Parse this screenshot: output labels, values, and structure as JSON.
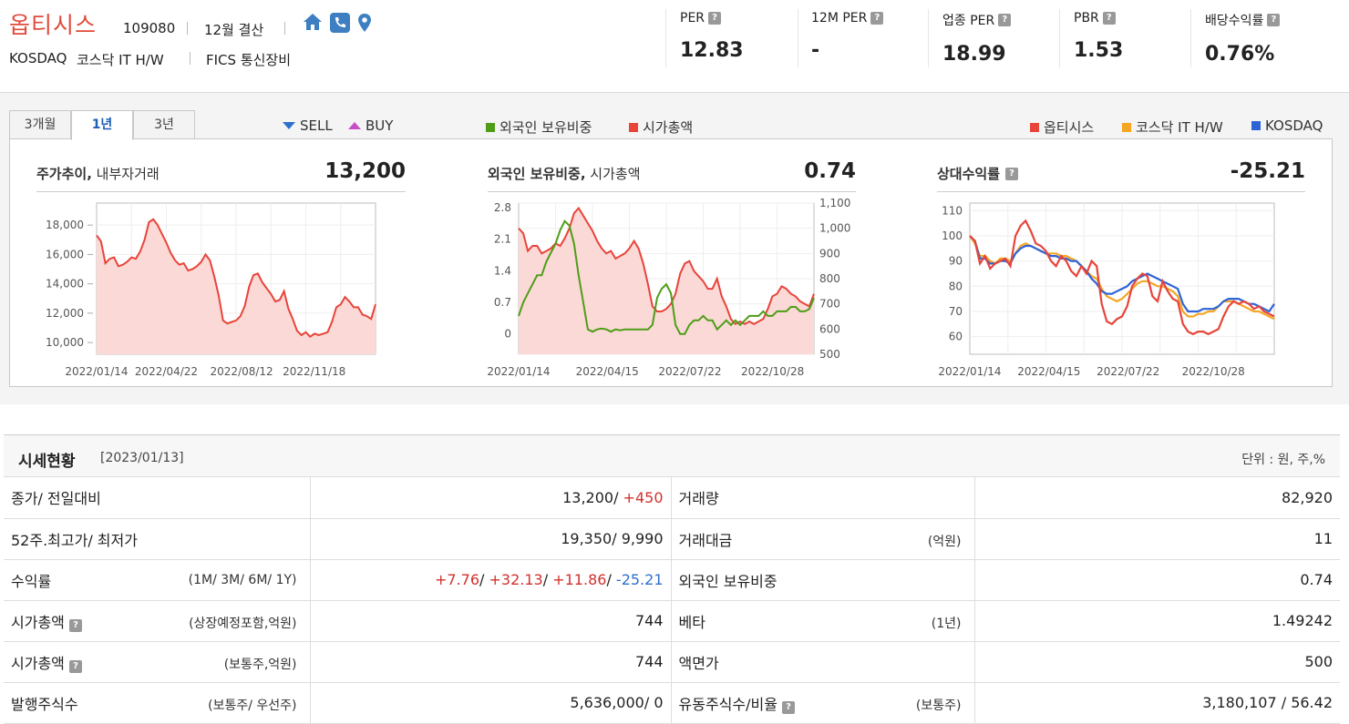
{
  "header": {
    "company": "옵티시스",
    "code": "109080",
    "fiscal": "12월 결산",
    "market": "KOSDAQ",
    "sector": "코스닥 IT H/W",
    "fics": "FICS 통신장비",
    "icons": [
      "home-icon",
      "phone-icon",
      "location-icon"
    ]
  },
  "metrics": [
    {
      "label": "PER",
      "value": "12.83"
    },
    {
      "label": "12M PER",
      "value": "-"
    },
    {
      "label": "업종 PER",
      "value": "18.99"
    },
    {
      "label": "PBR",
      "value": "1.53"
    },
    {
      "label": "배당수익률",
      "value": "0.76%"
    }
  ],
  "help_mark": "?",
  "tabs": [
    {
      "label": "3개월"
    },
    {
      "label": "1년",
      "active": true
    },
    {
      "label": "3년"
    }
  ],
  "legend": {
    "sell": "SELL",
    "buy": "BUY",
    "foreign": "외국인 보유비중",
    "mcap": "시가총액",
    "c1": "옵티시스",
    "c2": "코스닥 IT H/W",
    "c3": "KOSDAQ"
  },
  "colors": {
    "red": "#e8443a",
    "green": "#4e9d18",
    "orange": "#f5a623",
    "blue": "#2e64d6",
    "fill": "#fbd9d6",
    "sell": "#2e6fd0",
    "buy": "#c64fc6"
  },
  "panels": [
    {
      "title_bold": "주가추이,",
      "title_rest": " 내부자거래",
      "value": "13,200"
    },
    {
      "title_bold": "외국인 보유비중,",
      "title_rest": " 시가총액",
      "value": "0.74"
    },
    {
      "title_bold": "상대수익률",
      "title_rest": "",
      "value": "-25.21"
    }
  ],
  "chart_data": [
    {
      "type": "area",
      "series": [
        {
          "values": [
            17300,
            16900,
            15400,
            15700,
            15800,
            15200,
            15300,
            15500,
            15800,
            15700,
            16200,
            17000,
            18200,
            18400,
            18000,
            17400,
            16800,
            16100,
            15600,
            15300,
            15400,
            14900,
            15000,
            15200,
            15500,
            16000,
            15600,
            14500,
            13200,
            11500,
            11300,
            11400,
            11500,
            11800,
            12500,
            13800,
            14600,
            14700,
            14100,
            13700,
            13300,
            12800,
            12900,
            13500,
            12300,
            11600,
            10800,
            10500,
            10700,
            10400,
            10600,
            10500,
            10600,
            10700,
            11400,
            12400,
            12600,
            13100,
            12800,
            12400,
            12400,
            11900,
            11800,
            11600,
            12600
          ]
        }
      ],
      "y_ticks": [
        "18,000",
        "16,000",
        "14,000",
        "12,000",
        "10,000"
      ],
      "ylim": [
        9200,
        19500
      ],
      "x_ticks": [
        "2022/01/14",
        "2022/04/22",
        "2022/08/12",
        "2022/11/18"
      ]
    },
    {
      "type": "line",
      "series": [
        {
          "name": "외국인 보유비중",
          "axis": "left",
          "values": [
            0.4,
            0.7,
            0.9,
            1.1,
            1.3,
            1.3,
            1.6,
            1.8,
            2.0,
            2.3,
            2.5,
            2.4,
            2.0,
            1.3,
            0.7,
            0.1,
            0.05,
            0.1,
            0.12,
            0.1,
            0.05,
            0.1,
            0.08,
            0.1,
            0.1,
            0.1,
            0.1,
            0.1,
            0.1,
            0.2,
            0.8,
            1.0,
            1.1,
            0.9,
            0.2,
            0.0,
            0.0,
            0.2,
            0.3,
            0.3,
            0.4,
            0.3,
            0.3,
            0.1,
            0.2,
            0.3,
            0.2,
            0.3,
            0.2,
            0.3,
            0.4,
            0.4,
            0.4,
            0.5,
            0.4,
            0.4,
            0.5,
            0.5,
            0.5,
            0.6,
            0.6,
            0.5,
            0.5,
            0.55,
            0.8
          ]
        },
        {
          "name": "시가총액",
          "axis": "right",
          "values": [
            1000,
            980,
            910,
            930,
            930,
            900,
            910,
            920,
            940,
            930,
            960,
            1000,
            1060,
            1080,
            1050,
            1020,
            990,
            950,
            920,
            900,
            910,
            880,
            890,
            900,
            920,
            950,
            920,
            860,
            780,
            690,
            670,
            670,
            680,
            700,
            740,
            820,
            860,
            870,
            830,
            810,
            790,
            760,
            760,
            800,
            730,
            690,
            640,
            620,
            630,
            620,
            630,
            620,
            630,
            640,
            680,
            730,
            740,
            770,
            760,
            740,
            730,
            710,
            700,
            690,
            740
          ]
        }
      ],
      "y_ticks_left": [
        "2.8",
        "2.1",
        "1.4",
        "0.7",
        "0"
      ],
      "ylim_left": [
        -0.45,
        2.9
      ],
      "y_ticks_right": [
        "1,100",
        "1,000",
        "900",
        "800",
        "700",
        "600",
        "500"
      ],
      "ylim_right": [
        500,
        1100
      ],
      "x_ticks": [
        "2022/01/14",
        "2022/04/15",
        "2022/07/22",
        "2022/10/28"
      ]
    },
    {
      "type": "line",
      "series": [
        {
          "name": "옵티시스",
          "values": [
            100,
            98,
            89,
            92,
            87,
            89,
            90,
            91,
            88,
            100,
            104,
            106,
            102,
            97,
            96,
            94,
            90,
            88,
            92,
            90,
            86,
            84,
            88,
            85,
            90,
            88,
            73,
            66,
            65,
            67,
            68,
            72,
            80,
            83,
            85,
            84,
            76,
            74,
            82,
            78,
            75,
            74,
            65,
            62,
            61,
            62,
            62,
            61,
            62,
            63,
            68,
            72,
            74,
            73,
            74,
            73,
            71,
            72,
            70,
            69,
            68
          ]
        },
        {
          "name": "코스닥 IT H/W",
          "values": [
            100,
            97,
            92,
            92,
            90,
            89,
            91,
            91,
            90,
            93,
            96,
            97,
            96,
            95,
            94,
            93,
            93,
            93,
            92,
            92,
            91,
            90,
            88,
            86,
            84,
            83,
            79,
            76,
            75,
            74,
            75,
            77,
            79,
            81,
            82,
            82,
            81,
            80,
            80,
            79,
            78,
            76,
            70,
            68,
            68,
            69,
            69,
            70,
            70,
            72,
            74,
            74,
            74,
            73,
            72,
            71,
            70,
            70,
            69,
            68,
            67
          ]
        },
        {
          "name": "KOSDAQ",
          "values": [
            100,
            98,
            91,
            91,
            89,
            89,
            90,
            90,
            89,
            93,
            95,
            96,
            96,
            95,
            94,
            93,
            92,
            92,
            91,
            91,
            90,
            90,
            88,
            86,
            83,
            81,
            78,
            77,
            77,
            78,
            79,
            80,
            82,
            83,
            84,
            85,
            84,
            83,
            82,
            81,
            80,
            79,
            73,
            70,
            70,
            70,
            71,
            71,
            71,
            72,
            74,
            75,
            75,
            75,
            74,
            73,
            73,
            72,
            71,
            70,
            73
          ]
        }
      ],
      "y_ticks": [
        "110",
        "100",
        "90",
        "80",
        "70",
        "60"
      ],
      "ylim": [
        53,
        113
      ],
      "x_ticks": [
        "2022/01/14",
        "2022/04/15",
        "2022/07/22",
        "2022/10/28"
      ]
    }
  ],
  "section": {
    "title": "시세현황",
    "date": "[2023/01/13]",
    "unit": "단위 : 원, 주,%"
  },
  "rows": [
    {
      "l1": "종가/ 전일대비",
      "s1": "",
      "v1a": "13,200/ ",
      "v1b": "+450",
      "l2": "거래량",
      "s2": "",
      "v2": "82,920"
    },
    {
      "l1": "52주.최고가/ 최저가",
      "s1": "",
      "v1a": "19,350/ 9,990",
      "l2": "거래대금",
      "s2": "(억원)",
      "v2": "11"
    },
    {
      "l1": "수익률",
      "s1": "(1M/ 3M/ 6M/ 1Y)",
      "ret": [
        "+7.76",
        "+32.13",
        "+11.86",
        "-25.21"
      ],
      "l2": "외국인 보유비중",
      "s2": "",
      "v2": "0.74"
    },
    {
      "l1": "시가총액",
      "s1": "(상장예정포함,억원)",
      "help": true,
      "v1a": "744",
      "l2": "베타",
      "s2": "(1년)",
      "v2": "1.49242"
    },
    {
      "l1": "시가총액",
      "s1": "(보통주,억원)",
      "help": true,
      "v1a": "744",
      "l2": "액면가",
      "s2": "",
      "v2": "500"
    },
    {
      "l1": "발행주식수",
      "s1": "(보통주/ 우선주)",
      "v1a": "5,636,000/ 0",
      "l2": "유동주식수/비율",
      "help2": true,
      "s2": "(보통주)",
      "v2": "3,180,107 / 56.42"
    }
  ]
}
